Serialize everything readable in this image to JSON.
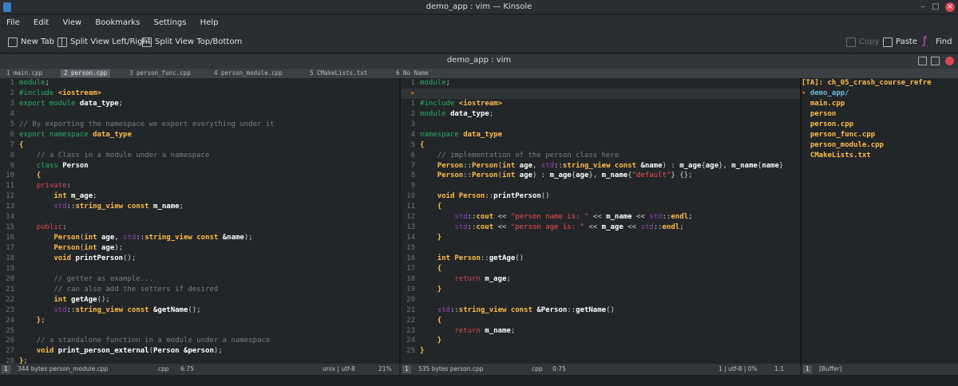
{
  "window": {
    "title": "demo_app : vim — Kinsole",
    "minimize": "–",
    "maximize": "□",
    "close": "×"
  },
  "menu": [
    "File",
    "Edit",
    "View",
    "Bookmarks",
    "Settings",
    "Help"
  ],
  "toolbar": {
    "new_tab": "New Tab",
    "split_lr": "Split View Left/Right",
    "split_tb": "Split View Top/Bottom",
    "copy": "Copy",
    "paste": "Paste",
    "find": "Find"
  },
  "document": {
    "title": "demo_app : vim"
  },
  "tabs": [
    "1 main.cpp",
    "2 person.cpp",
    "3 person_func.cpp",
    "4 person_module.cpp",
    "5 CMakeLists.txt",
    "6 No Name"
  ],
  "left_pane": {
    "status_size": "344 bytes person_module.cpp",
    "status_type": "cpp",
    "status_pos": "6:75",
    "status_right": "unix | utf-8",
    "status_pct": "21%"
  },
  "middle_pane": {
    "status_size": "535 bytes person.cpp",
    "status_type": "cpp",
    "status_pos": "0:75",
    "status_right": "1 | utf-8 | 0%",
    "status_mode": "1:1"
  },
  "tree": {
    "header": "[TA]: ch_05_crash_course_refre",
    "status": "[Buffer]",
    "items": [
      "demo_app/",
      "main.cpp",
      "person",
      "person.cpp",
      "person_func.cpp",
      "person_module.cpp",
      "CMakeLists.txt"
    ]
  },
  "colors": {
    "background": "#232629",
    "keyword": "#27ae60",
    "type": "#fdbc4b",
    "comment": "#7a7c7d",
    "accent": "#e94bb0",
    "close": "#da4453"
  }
}
